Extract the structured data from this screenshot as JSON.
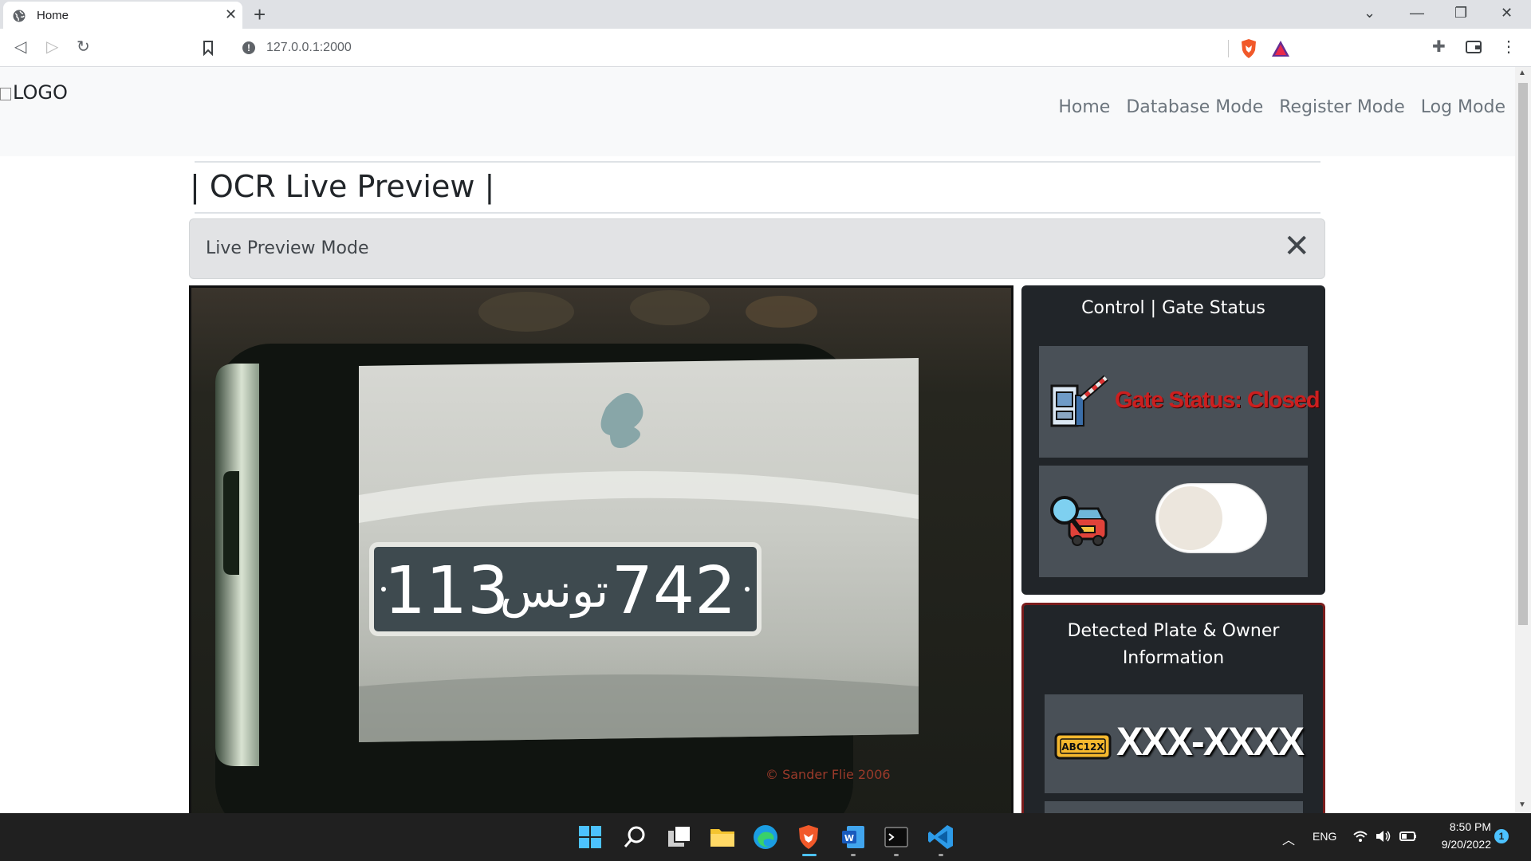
{
  "browser": {
    "tab_title": "Home",
    "url": "127.0.0.1:2000"
  },
  "navbar": {
    "logo_alt": "LOGO",
    "links": [
      "Home",
      "Database Mode",
      "Register Mode",
      "Log Mode"
    ]
  },
  "page": {
    "title": "| OCR Live Preview |",
    "alert_text": "Live Preview Mode"
  },
  "camera": {
    "plate_left_number": "113",
    "plate_arabic": "تونس",
    "plate_right_number": "742",
    "watermark": "© Sander Flie 2006"
  },
  "control_card": {
    "title": "Control | Gate Status",
    "gate_status": "Gate Status: Closed",
    "toggle_on": false,
    "status_color": "#cc1f1f"
  },
  "detected_card": {
    "title": "Detected Plate & Owner Information",
    "plate_icon_text": "ABC12X",
    "plate_value": "XXX-XXXX"
  },
  "taskbar": {
    "language": "ENG",
    "time": "8:50 PM",
    "date": "9/20/2022",
    "notification_count": "1"
  }
}
